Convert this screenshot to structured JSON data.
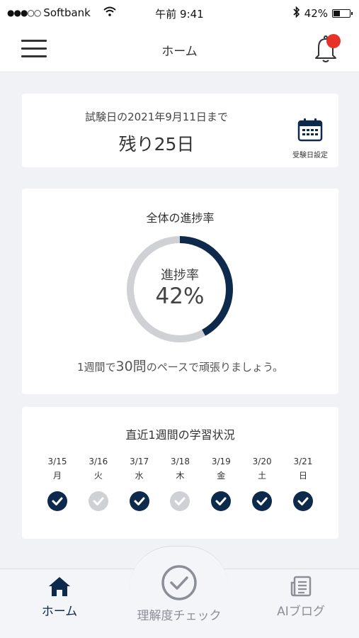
{
  "status_bar": {
    "carrier": "Softbank",
    "time": "午前 9:41",
    "battery": "42%",
    "battery_level": 0.42
  },
  "header": {
    "title": "ホーム"
  },
  "exam": {
    "date_text": "試験日の2021年9月11日まで",
    "remaining": "残り25日",
    "settings_label": "受験日設定"
  },
  "progress": {
    "title": "全体の進捗率",
    "ring_label": "進捗率",
    "value_text": "42%",
    "value": 0.42,
    "pace_prefix": "1週間で",
    "pace_number": "30問",
    "pace_suffix": "のペースで頑張りましょう。"
  },
  "week": {
    "title": "直近1週間の学習状況",
    "days": [
      {
        "date": "3/15",
        "weekday": "月",
        "done": true
      },
      {
        "date": "3/16",
        "weekday": "火",
        "done": false
      },
      {
        "date": "3/17",
        "weekday": "水",
        "done": true
      },
      {
        "date": "3/18",
        "weekday": "木",
        "done": false
      },
      {
        "date": "3/19",
        "weekday": "金",
        "done": true
      },
      {
        "date": "3/20",
        "weekday": "土",
        "done": true
      },
      {
        "date": "3/21",
        "weekday": "日",
        "done": true
      }
    ]
  },
  "tabs": {
    "home": "ホーム",
    "check": "理解度チェック",
    "blog": "AIブログ"
  },
  "colors": {
    "accent": "#0d2a4d",
    "ring_track": "#cfd1d4",
    "badge": "#e5332a"
  }
}
